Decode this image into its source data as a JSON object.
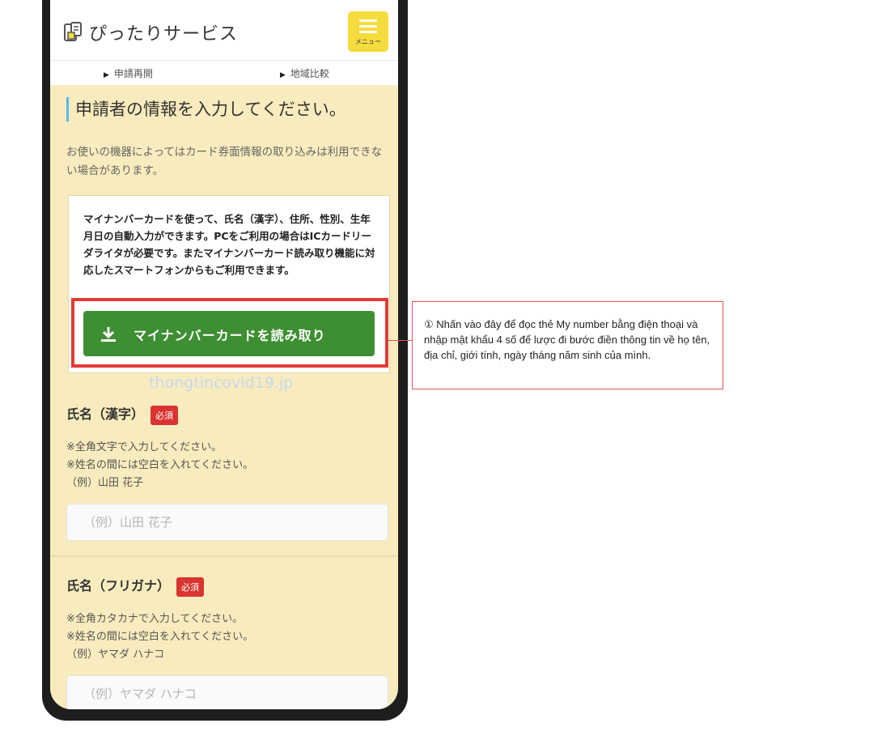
{
  "header": {
    "app_title": "ぴったりサービス",
    "menu_label": "メニュー"
  },
  "subnav": {
    "items": [
      "申請再開",
      "地域比較"
    ]
  },
  "section": {
    "heading": "申請者の情報を入力してください。",
    "notice": "お使いの機器によってはカード券面情報の取り込みは利用できない場合があります。"
  },
  "mynumber_card": {
    "description": "マイナンバーカードを使って、氏名（漢字）、住所、性別、生年月日の自動入力ができます。PCをご利用の場合はICカードリーダライタが必要です。またマイナンバーカード読み取り機能に対応したスマートフォンからもご利用できます。",
    "button_label": "マイナンバーカードを読み取り"
  },
  "watermark": "thongtincovid19.jp",
  "fields": {
    "name_kanji": {
      "label": "氏名（漢字）",
      "required_badge": "必須",
      "help_1": "※全角文字で入力してください。",
      "help_2": "※姓名の間には空白を入れてください。",
      "help_3": "（例）山田 花子",
      "placeholder": "（例）山田 花子"
    },
    "name_furigana": {
      "label": "氏名（フリガナ）",
      "required_badge": "必須",
      "help_1": "※全角カタカナで入力してください。",
      "help_2": "※姓名の間には空白を入れてください。",
      "help_3": "（例）ヤマダ ハナコ",
      "placeholder": "（例）ヤマダ ハナコ"
    }
  },
  "annotation": {
    "callout_text": "① Nhấn vào đây để đọc thẻ My number bằng điện thoại và nhập mật khẩu 4 số để lược đi bước điền thông tin về họ tên, địa chỉ, giới tính, ngày tháng năm sinh của mình."
  },
  "colors": {
    "page_background": "#f8ebbd",
    "menu_button": "#f5dc3e",
    "primary_button": "#3e8f33",
    "required_badge": "#d93431",
    "heading_accent": "#5ab8e8",
    "annotation_red": "#e53a34"
  }
}
